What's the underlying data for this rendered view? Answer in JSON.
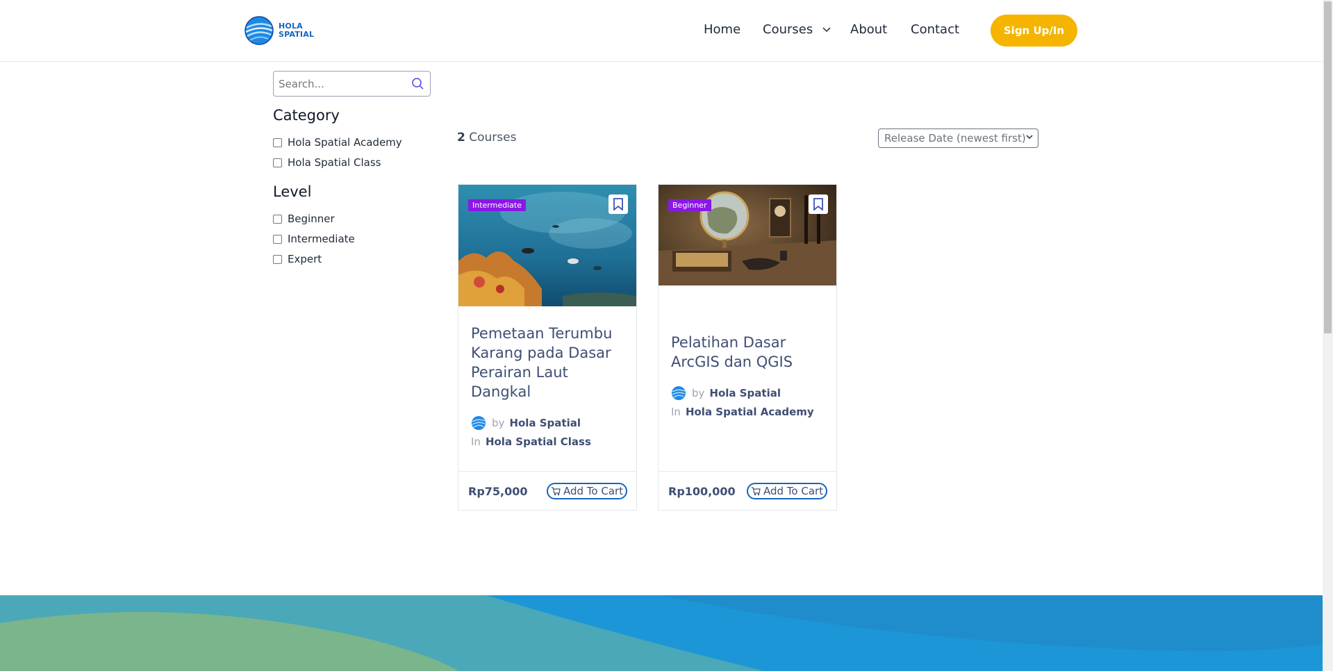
{
  "header": {
    "logo_line1": "HOLA",
    "logo_line2": "SPATIAL",
    "nav": [
      {
        "label": "Home"
      },
      {
        "label": "Courses"
      },
      {
        "label": "About"
      },
      {
        "label": "Contact"
      }
    ],
    "signup_label": "Sign Up/In"
  },
  "sidebar": {
    "search_placeholder": "Search...",
    "category_heading": "Category",
    "categories": [
      "Hola Spatial Academy",
      "Hola Spatial Class"
    ],
    "level_heading": "Level",
    "levels": [
      "Beginner",
      "Intermediate",
      "Expert"
    ]
  },
  "courses_header": {
    "count": "2",
    "count_label": "Courses",
    "sort_selected": "Release Date (newest first)"
  },
  "courses": [
    {
      "level_badge": "Intermediate",
      "title": "Pemetaan Terumbu Karang pada Dasar Perairan Laut Dangkal",
      "by_label": "by",
      "author": "Hola Spatial",
      "in_label": "In",
      "category": "Hola Spatial Class",
      "price": "Rp75,000",
      "cart_label": "Add To Cart"
    },
    {
      "level_badge": "Beginner",
      "title": "Pelatihan Dasar ArcGIS dan QGIS",
      "by_label": "by",
      "author": "Hola Spatial",
      "in_label": "In",
      "category": "Hola Spatial Academy",
      "price": "Rp100,000",
      "cart_label": "Add To Cart"
    }
  ],
  "colors": {
    "accent": "#f5b400",
    "badge": "#8b17e6",
    "primary": "#1565c0",
    "title_text": "#3f4e74"
  }
}
